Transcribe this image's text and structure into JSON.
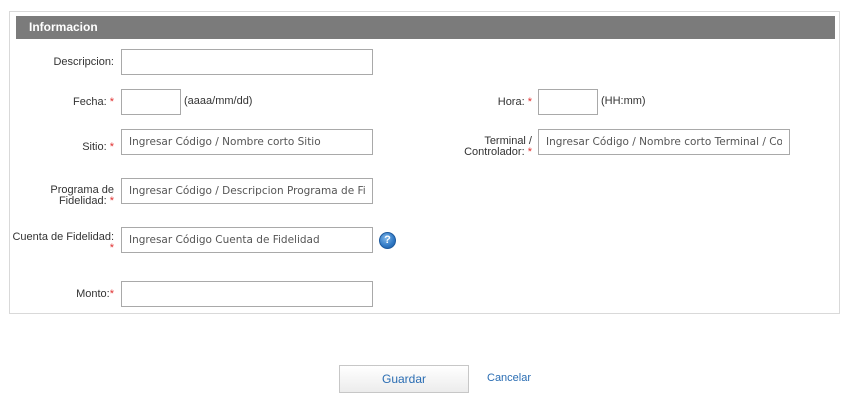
{
  "panel": {
    "title": "Informacion"
  },
  "fields": {
    "descripcion": {
      "label": "Descripcion:",
      "value": "",
      "placeholder": ""
    },
    "fecha": {
      "label": "Fecha:",
      "required_mark": "*",
      "value": "",
      "hint": "(aaaa/mm/dd)"
    },
    "hora": {
      "label": "Hora:",
      "required_mark": "*",
      "value": "",
      "hint": "(HH:mm)"
    },
    "sitio": {
      "label": "Sitio:",
      "required_mark": "*",
      "placeholder": "Ingresar Código / Nombre corto Sitio"
    },
    "terminal": {
      "label_line1": "Terminal /",
      "label_line2": "Controlador:",
      "required_mark": "*",
      "placeholder": "Ingresar Código / Nombre corto Terminal / Cont"
    },
    "programa": {
      "label_line1": "Programa de",
      "label_line2": "Fidelidad:",
      "required_mark": "*",
      "placeholder": "Ingresar Código / Descripcion Programa de Fidel"
    },
    "cuenta": {
      "label": "Cuenta de Fidelidad:",
      "required_mark": "*",
      "placeholder": "Ingresar Código Cuenta de Fidelidad",
      "help_icon": "help-icon",
      "help_glyph": "?"
    },
    "monto": {
      "label": "Monto:",
      "required_mark": "*",
      "value": ""
    }
  },
  "actions": {
    "save_label": "Guardar",
    "cancel_label": "Cancelar"
  },
  "colors": {
    "header_bg": "#7b7b7b",
    "required": "#e03030",
    "link": "#2a6db3"
  }
}
